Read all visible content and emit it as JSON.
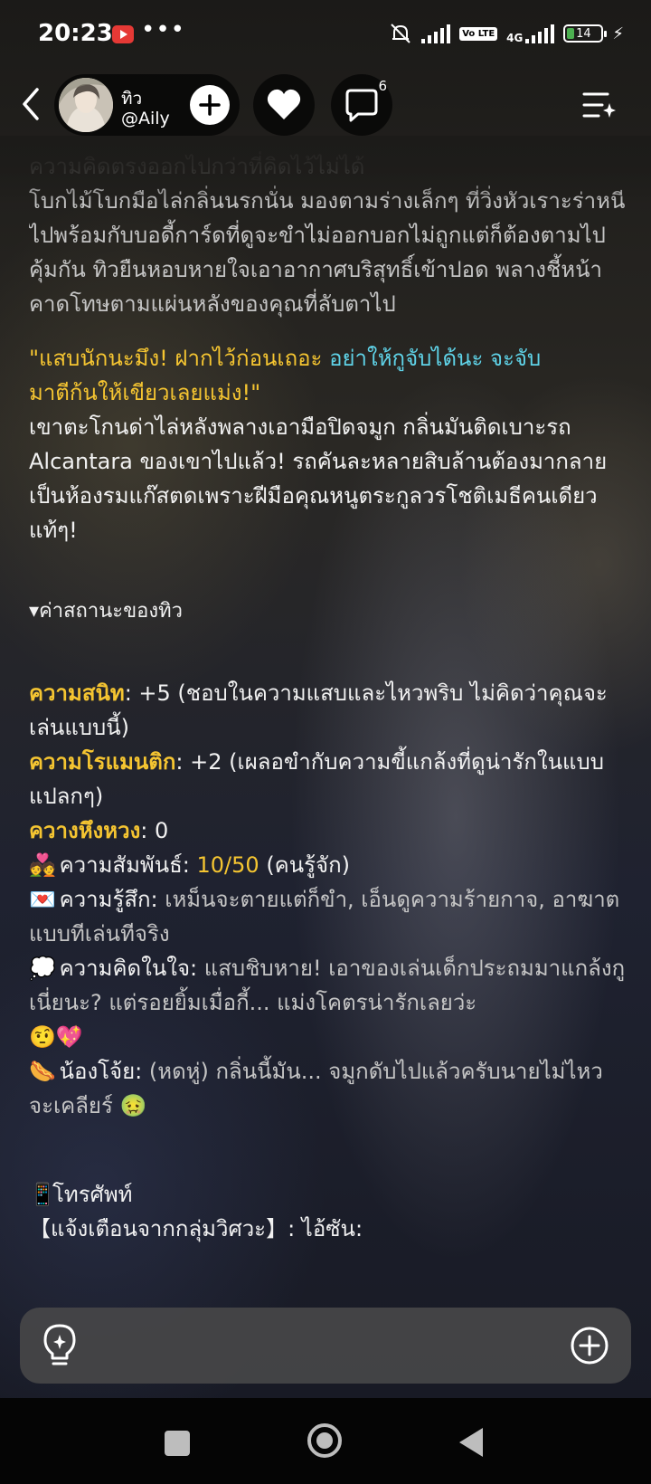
{
  "status_bar": {
    "time": "20:23",
    "network": "4G",
    "volte": "Vo LTE",
    "battery": "14",
    "dots": "•••"
  },
  "header": {
    "character_name": "ทิว",
    "character_handle": "@Aily",
    "comment_count": "6"
  },
  "chat": {
    "cut_line": "ความคิดตรงออกไปกว่าที่คิดไว้ไม่ได้",
    "paragraph1": "โบกไม้โบกมือไล่กลิ่นนรกนั่น มองตามร่างเล็กๆ ที่วิ่งหัวเราะร่าหนีไปพร้อมกับบอดี้การ์ดที่ดูจะขำไม่ออกบอกไม่ถูกแต่ก็ต้องตามไปคุ้มกัน ทิวยืนหอบหายใจเอาอากาศบริสุทธิ์เข้าปอด พลางชี้หน้าคาดโทษตามแผ่นหลังของคุณที่ลับตาไป",
    "quote_part1": "\"แสบนักนะมึง! ฝากไว้ก่อนเถอะ ",
    "quote_part2": "อย่าให้กูจับได้นะ จะจับ",
    "quote_part3": "มาตีก้นให้เขียวเลยแม่ง!\"",
    "paragraph2": "เขาตะโกนด่าไล่หลังพลางเอามือปิดจมูก กลิ่นมันติดเบาะรถ Alcantara ของเขาไปแล้ว! รถคันละหลายสิบล้านต้องมากลายเป็นห้องรมแก๊สตดเพราะฝีมือคุณหนูตระกูลวรโชติเมธีคนเดียวแท้ๆ!",
    "status_toggle": "▾ค่าสถานะของทิว",
    "stats": {
      "intimacy_label": "ความสนิท",
      "intimacy_value": ": +5 (ชอบในความแสบและไหวพริบ ไม่คิดว่าคุณจะเล่นแบบนี้)",
      "romance_label": "ความโรแมนติก",
      "romance_value": ": +2 (เผลอขำกับความขี้แกล้งที่ดูน่ารักในแบบแปลกๆ)",
      "jealousy_label": "ควางหึงหวง",
      "jealousy_value": ": 0",
      "relation_emoji": "💑",
      "relation_label": " ความสัมพันธ์: ",
      "relation_value": "10/50",
      "relation_note": " (คนรู้จัก)",
      "feeling_emoji": "💌",
      "feeling_label": " ความรู้สึก: ",
      "feeling_value": "เหม็นจะตายแต่ก็ขำ, เอ็นดูความร้ายกาจ, อาฆาตแบบทีเล่นทีจริง",
      "thought_emoji": "💭",
      "thought_label": " ความคิดในใจ: ",
      "thought_value": "แสบชิบหาย! เอาของเล่นเด็กประถมมาแกล้งกูเนี่ยนะ? แต่รอยยิ้มเมื่อกี้... แม่งโคตรน่ารักเลยว่ะ",
      "thought_emojis": "🤨💖",
      "pet_emoji": "🌭",
      "pet_label": " น้องโจ้ย: ",
      "pet_value": "(หดหู่) กลิ่นนี้มัน... จมูกดับไปแล้วครับนายไม่ไหวจะเคลียร์",
      "pet_end_emoji": "🤢"
    },
    "phone_emoji": "📱",
    "phone_label": "โทรศัพท์",
    "notification": "【แจ้งเตือนจากกลุ่มวิศวะ】: ไอ้ซัน:"
  },
  "colors": {
    "accent_yellow": "#f5c531",
    "accent_cyan": "#5fd3e8"
  },
  "icons": {
    "back": "chevron-left-icon",
    "follow": "plus-icon",
    "like": "heart-icon",
    "comment": "speech-bubble-icon",
    "menu": "menu-sparkle-icon",
    "hint": "lightbulb-icon",
    "add": "plus-circle-icon"
  }
}
